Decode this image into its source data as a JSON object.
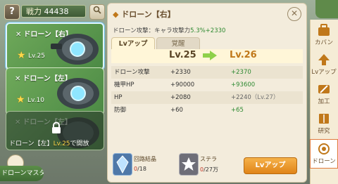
{
  "header": {
    "help_icon": "?",
    "power_label": "戦力",
    "power_value": "44438",
    "search_icon": "search-icon"
  },
  "drones": [
    {
      "title": "ドローン【右】",
      "level": "Lv.25",
      "selected": true
    },
    {
      "title": "ドローン【左】",
      "level": "Lv.10",
      "selected": false
    },
    {
      "title": "ドローン【左】",
      "locked": true,
      "unlock_prefix": "ドローン【左】",
      "unlock_level": "Lv.25",
      "unlock_suffix": "で開放"
    }
  ],
  "master_label": "ドローンマスター",
  "panel": {
    "title": "ドローン【右】",
    "bonus_label": "ドローン攻撃：キャラ攻撃力",
    "bonus_value": "5.3%+2330",
    "tabs": [
      "Lvアップ",
      "覚醒"
    ],
    "level_current": "Lv.25",
    "level_next": "Lv.26",
    "stats": [
      {
        "name": "ドローン攻撃",
        "current": "+2330",
        "next": "+2370",
        "note": ""
      },
      {
        "name": "機甲HP",
        "current": "+90000",
        "next": "+93600",
        "note": ""
      },
      {
        "name": "HP",
        "current": "+2080",
        "next": "+2240",
        "note": "（Lv.27）"
      },
      {
        "name": "防御",
        "current": "+60",
        "next": "+65",
        "note": ""
      }
    ],
    "materials": [
      {
        "name": "回路結晶",
        "have": "0",
        "need": "/18"
      },
      {
        "name": "ステラ",
        "have": "0",
        "need": "/27万"
      }
    ],
    "levelup_button": "Lvアップ",
    "close_icon": "✕"
  },
  "sidebar": [
    {
      "label": "カバン",
      "icon": "bag-icon"
    },
    {
      "label": "Lvアップ",
      "icon": "arrow-up-icon"
    },
    {
      "label": "加工",
      "icon": "wrench-icon"
    },
    {
      "label": "研究",
      "icon": "book-icon"
    },
    {
      "label": "ドローン",
      "icon": "drone-icon",
      "active": true
    }
  ],
  "colors": {
    "accent": "#e08418",
    "green": "#2f8a32",
    "panel": "#f3ecdc"
  }
}
